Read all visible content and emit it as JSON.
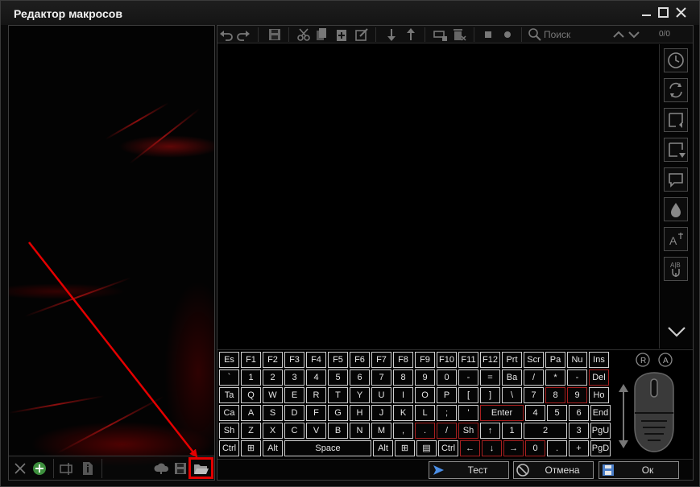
{
  "window": {
    "title": "Редактор макросов",
    "controls": [
      "minimize",
      "maximize",
      "close"
    ]
  },
  "left_bottom": {
    "icons": [
      "close-icon",
      "add-icon",
      "rename-icon",
      "info-icon",
      "cloud-icon",
      "save-icon",
      "folder-open-icon"
    ]
  },
  "toolbar": {
    "search_placeholder": "Поиск",
    "counter": "0/0",
    "icons": [
      "undo-icon",
      "redo-icon",
      "save-icon",
      "cut-icon",
      "copy-icon",
      "paste-icon",
      "edit-icon",
      "move-down-icon",
      "move-up-icon",
      "add-loop-icon",
      "delete-icon",
      "stop-icon",
      "record-icon",
      "search-icon",
      "chevron-up-icon",
      "chevron-down-icon"
    ]
  },
  "side_tools": {
    "icons": [
      "clock-icon",
      "loop-icon",
      "insert-above-icon",
      "insert-below-icon",
      "comment-icon",
      "drop-icon",
      "text-icon",
      "ab-switch-icon",
      "chevron-down-icon"
    ],
    "text_labels": [
      "A",
      "A|B"
    ]
  },
  "keyboard": {
    "rows": [
      [
        "Es",
        "F1",
        "F2",
        "F3",
        "F4",
        "F5",
        "F6",
        "F7",
        "F8",
        "F9",
        "F10",
        "F11",
        "F12",
        "Prt",
        "Scr",
        "Pa",
        "Nu",
        "Ins"
      ],
      [
        "`",
        "1",
        "2",
        "3",
        "4",
        "5",
        "6",
        "7",
        "8",
        "9",
        "0",
        "-",
        "=",
        "Ba",
        "/",
        "*",
        "-",
        "Del"
      ],
      [
        "Ta",
        "Q",
        "W",
        "E",
        "R",
        "T",
        "Y",
        "U",
        "I",
        "O",
        "P",
        "[",
        "]",
        "\\",
        "7",
        "8",
        "9",
        "Ho"
      ],
      [
        "Ca",
        "A",
        "S",
        "D",
        "F",
        "G",
        "H",
        "J",
        "K",
        "L",
        ";",
        "'",
        "Enter",
        "4",
        "5",
        "6",
        "End"
      ],
      [
        "Sh",
        "Z",
        "X",
        "C",
        "V",
        "B",
        "N",
        "M",
        ",",
        ".",
        "/",
        "Sh",
        "↑",
        "1",
        "2",
        "3",
        "PgU"
      ],
      [
        "Ctrl",
        "⊞",
        "Alt",
        "Space",
        "Alt",
        "⊞",
        "▤",
        "Ctrl",
        "←",
        "↓",
        "→",
        "0",
        ".",
        "+",
        "PgD"
      ]
    ]
  },
  "mouse": {
    "labels": [
      "R",
      "A"
    ]
  },
  "actions": {
    "test": "Тест",
    "cancel": "Отмена",
    "ok": "Ок"
  },
  "colors": {
    "highlight": "#e40000",
    "background": "#000000",
    "accent_red": "#a82020"
  }
}
